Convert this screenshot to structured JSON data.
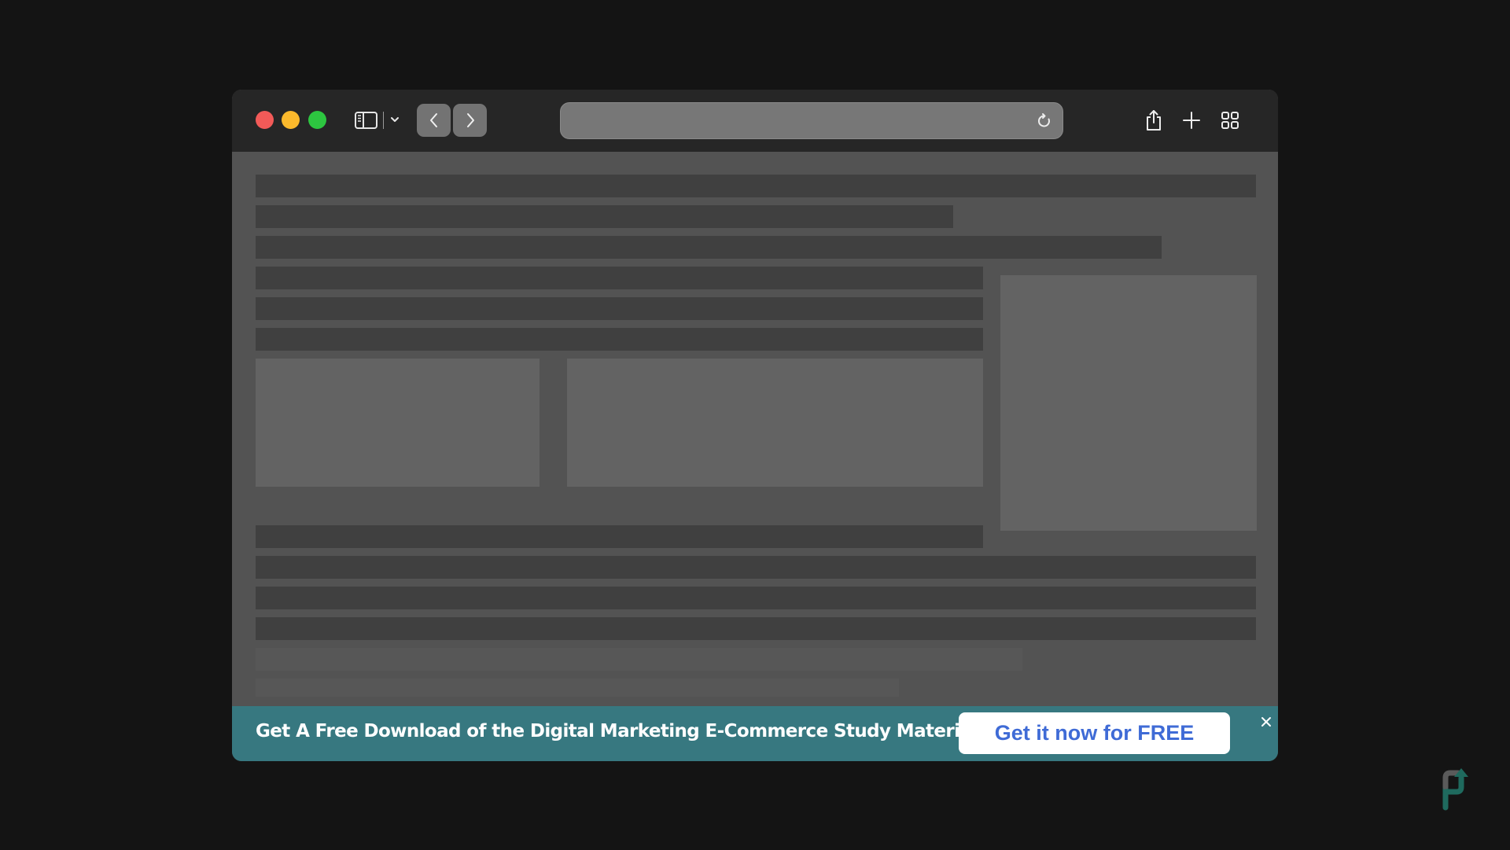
{
  "browser": {
    "window_controls": [
      "close",
      "minimize",
      "maximize"
    ],
    "toolbar": {
      "sidebar_icon": "sidebar-icon",
      "sidebar_menu_icon": "chevron-down-icon",
      "back_icon": "chevron-left-icon",
      "forward_icon": "chevron-right-icon",
      "address_value": "",
      "reload_icon": "reload-icon",
      "share_icon": "share-icon",
      "new_tab_icon": "plus-icon",
      "tab_overview_icon": "grid-icon"
    }
  },
  "page": {
    "state": "loading-skeleton"
  },
  "banner": {
    "message": "Get A Free Download of the Digital Marketing E-Commerce Study Material",
    "cta_label": "Get it now for FREE",
    "close_icon": "close-icon",
    "background_color": "#377880",
    "cta_text_color": "#3f6bd6"
  },
  "colors": {
    "traffic_red": "#f25a58",
    "traffic_yellow": "#fbb92c",
    "traffic_green": "#2dc640"
  },
  "logo": {
    "name": "brand-logo"
  }
}
